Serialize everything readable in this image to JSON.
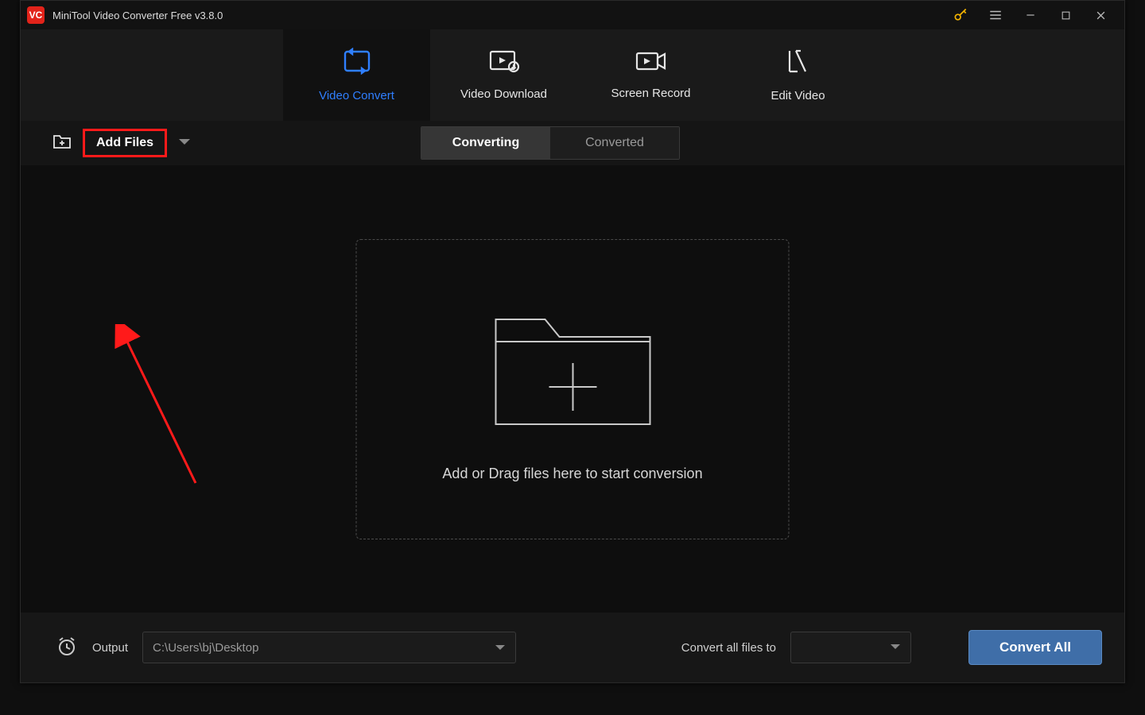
{
  "app": {
    "title": "MiniTool Video Converter Free v3.8.0",
    "logo_text": "VC"
  },
  "main_tabs": [
    {
      "label": "Video Convert",
      "icon": "convert"
    },
    {
      "label": "Video Download",
      "icon": "download"
    },
    {
      "label": "Screen Record",
      "icon": "record"
    },
    {
      "label": "Edit Video",
      "icon": "edit"
    }
  ],
  "subbar": {
    "add_files_label": "Add Files"
  },
  "segmented": {
    "converting": "Converting",
    "converted": "Converted"
  },
  "dropzone": {
    "text": "Add or Drag files here to start conversion"
  },
  "footer": {
    "output_label": "Output",
    "output_path": "C:\\Users\\bj\\Desktop",
    "convert_all_label": "Convert all files to",
    "format_selected": "",
    "convert_button": "Convert All"
  },
  "colors": {
    "accent_blue": "#2f7fff",
    "annotation_red": "#ff1a1a",
    "primary_button": "#3f6ea8"
  }
}
